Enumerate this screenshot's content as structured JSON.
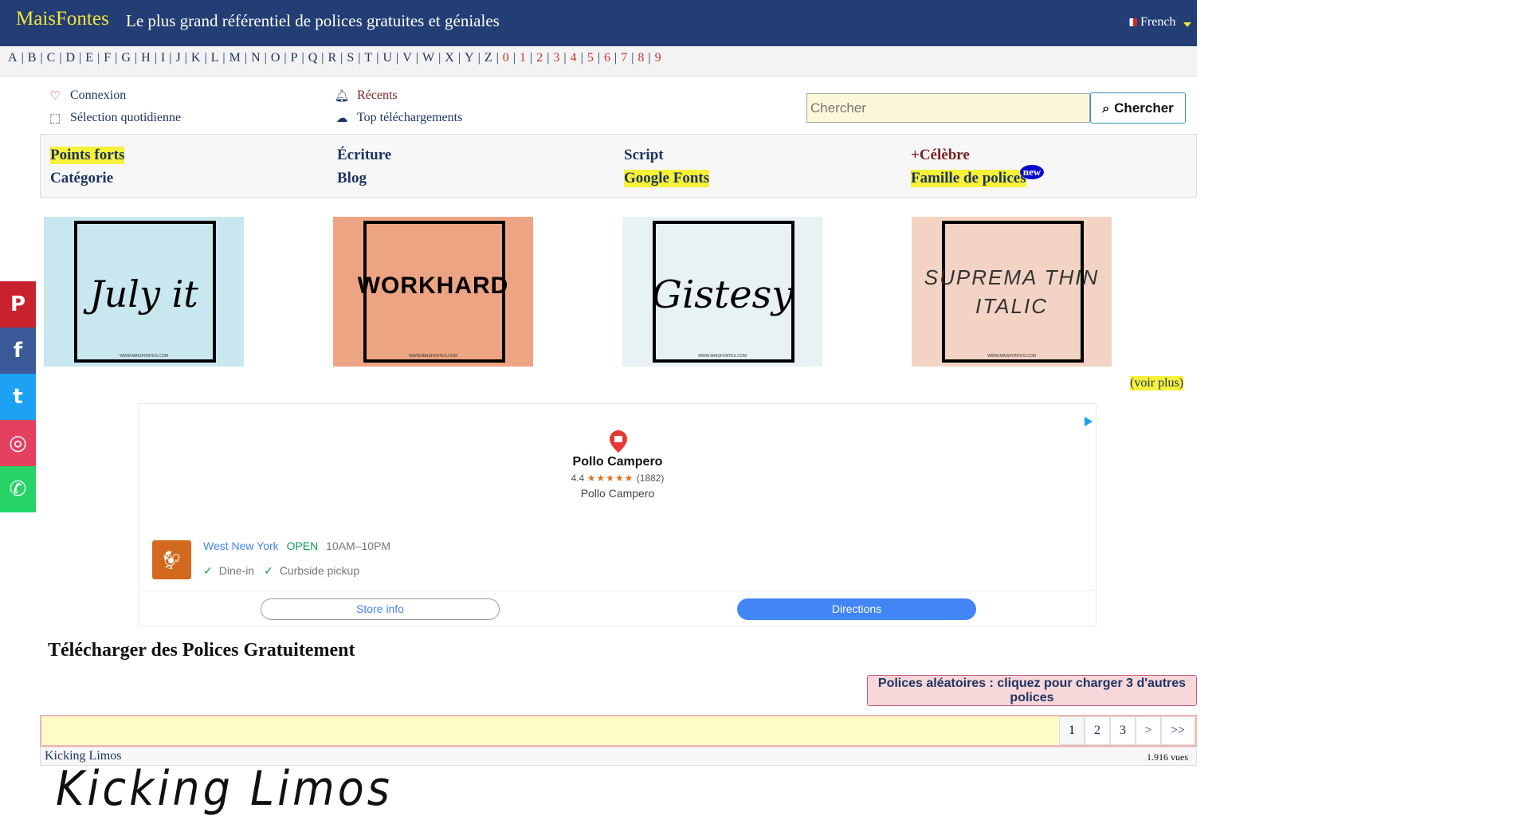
{
  "header": {
    "logo": "MaisFontes",
    "tagline": "Le plus grand référentiel de polices gratuites et géniales",
    "language": "French"
  },
  "alphabet": [
    "A",
    "B",
    "C",
    "D",
    "E",
    "F",
    "G",
    "H",
    "I",
    "J",
    "K",
    "L",
    "M",
    "N",
    "O",
    "P",
    "Q",
    "R",
    "S",
    "T",
    "U",
    "V",
    "W",
    "X",
    "Y",
    "Z"
  ],
  "digits": [
    "0",
    "1",
    "2",
    "3",
    "4",
    "5",
    "6",
    "7",
    "8",
    "9"
  ],
  "social_top": [
    {
      "icon": "pinterest-icon",
      "glyph": "P"
    },
    {
      "icon": "facebook-icon",
      "glyph": "f"
    },
    {
      "icon": "instagram-icon",
      "glyph": "◎"
    },
    {
      "icon": "twitter-icon",
      "glyph": "t"
    }
  ],
  "quick_links": {
    "login": "Connexion",
    "daily": "Sélection quotidienne",
    "recent": "Récents",
    "top": "Top téléchargements"
  },
  "search": {
    "placeholder": "Chercher",
    "button": "Chercher"
  },
  "menu": {
    "highlights": "Points forts",
    "writing": "Écriture",
    "script": "Script",
    "famous": "+Célèbre",
    "category": "Catégorie",
    "blog": "Blog",
    "google": "Google Fonts",
    "family": "Famille de polices",
    "new_badge": "new"
  },
  "thumbnails": [
    {
      "text": "July it",
      "bg": "#c9e7ef",
      "watermark": "WWW.MAISFONTES.COM"
    },
    {
      "text": "WORKHARD",
      "bg": "#eda483",
      "watermark": "WWW.MAISFONTES.COM"
    },
    {
      "text": "Gistesy",
      "bg": "#e8f2f5",
      "watermark": "WWW.MAISFONTES.COM"
    },
    {
      "text": "SUPREMA THIN ITALIC",
      "bg": "#f3d3c4",
      "watermark": "WWW.MAISFONTES.COM"
    }
  ],
  "see_more": "(voir plus)",
  "ad": {
    "title": "Pollo Campero",
    "rating": "4.4",
    "stars": "★★★★★",
    "reviews": "(1882)",
    "subtitle": "Pollo Campero",
    "city": "West New York",
    "status": "OPEN",
    "hours": "10AM–10PM",
    "feature1": "Dine-in",
    "feature2": "Curbside pickup",
    "store_info": "Store info",
    "directions": "Directions"
  },
  "heading": "Télécharger des Polices Gratuitement",
  "random_button": "Polices aléatoires : cliquez pour charger 3 d'autres polices",
  "pager": [
    "1",
    "2",
    "3",
    ">",
    ">>"
  ],
  "font": {
    "name": "Kicking Limos",
    "views": "1.916 vues",
    "preview": "Kicking Limos"
  },
  "sidebar_share": [
    {
      "icon": "pinterest-icon",
      "glyph": "P",
      "color": "#c8232c"
    },
    {
      "icon": "facebook-icon",
      "glyph": "f",
      "color": "#3b5998"
    },
    {
      "icon": "twitter-icon",
      "glyph": "t",
      "color": "#1da1f2"
    },
    {
      "icon": "instagram-icon",
      "glyph": "◎",
      "color": "#e4405f"
    },
    {
      "icon": "whatsapp-icon",
      "glyph": "✆",
      "color": "#25d366"
    }
  ]
}
